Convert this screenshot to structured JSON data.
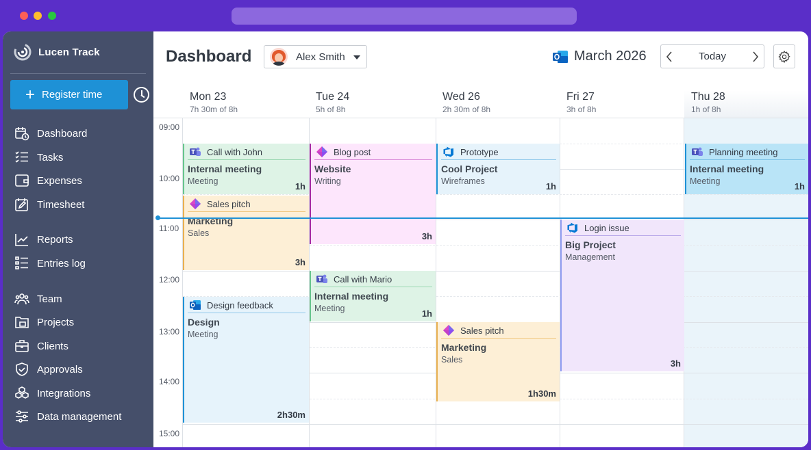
{
  "app": {
    "name": "Lucen Track"
  },
  "sidebar": {
    "register_label": "Register time",
    "items": [
      {
        "label": "Dashboard",
        "icon": "calendar-clock-icon"
      },
      {
        "label": "Tasks",
        "icon": "checklist-icon"
      },
      {
        "label": "Expenses",
        "icon": "wallet-icon"
      },
      {
        "label": "Timesheet",
        "icon": "timesheet-icon"
      },
      {
        "label": "Reports",
        "icon": "chart-line-icon"
      },
      {
        "label": "Entries log",
        "icon": "list-icon"
      },
      {
        "label": "Team",
        "icon": "team-icon"
      },
      {
        "label": "Projects",
        "icon": "folder-icon"
      },
      {
        "label": "Clients",
        "icon": "briefcase-icon"
      },
      {
        "label": "Approvals",
        "icon": "shield-check-icon"
      },
      {
        "label": "Integrations",
        "icon": "cubes-icon"
      },
      {
        "label": "Data management",
        "icon": "sliders-icon"
      }
    ]
  },
  "header": {
    "title": "Dashboard",
    "user": "Alex Smith",
    "month": "March 2026",
    "today_label": "Today"
  },
  "days": [
    {
      "name": "Mon 23",
      "summary": "7h 30m of 8h"
    },
    {
      "name": "Tue 24",
      "summary": "5h of 8h"
    },
    {
      "name": "Wed 26",
      "summary": "2h 30m of 8h"
    },
    {
      "name": "Fri 27",
      "summary": "3h of 8h"
    },
    {
      "name": "Thu 28",
      "summary": "1h of 8h"
    }
  ],
  "hours": [
    "09:00",
    "10:00",
    "11:00",
    "12:00",
    "13:00",
    "14:00",
    "15:00"
  ],
  "events": [
    {
      "title": "Call with John",
      "project": "Internal meeting",
      "task": "Meeting",
      "duration": "1h",
      "source": "teams"
    },
    {
      "title": "Sales pitch",
      "project": "Marketing",
      "task": "Sales",
      "duration": "3h",
      "source": "clickup"
    },
    {
      "title": "Design feedback",
      "project": "Design",
      "task": "Meeting",
      "duration": "2h30m",
      "source": "outlook"
    },
    {
      "title": "Blog post",
      "project": "Website",
      "task": "Writing",
      "duration": "3h",
      "source": "clickup"
    },
    {
      "title": "Call with Mario",
      "project": "Internal meeting",
      "task": "Meeting",
      "duration": "1h",
      "source": "teams"
    },
    {
      "title": "Prototype",
      "project": "Cool Project",
      "task": "Wireframes",
      "duration": "1h",
      "source": "azure-devops"
    },
    {
      "title": "Sales pitch",
      "project": "Marketing",
      "task": "Sales",
      "duration": "1h30m",
      "source": "clickup"
    },
    {
      "title": "Login issue",
      "project": "Big Project",
      "task": "Management",
      "duration": "3h",
      "source": "azure-devops"
    },
    {
      "title": "Planning meeting",
      "project": "Internal meeting",
      "task": "Meeting",
      "duration": "1h",
      "source": "teams"
    }
  ]
}
